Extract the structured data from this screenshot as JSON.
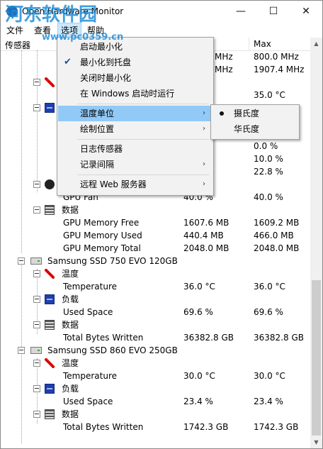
{
  "window": {
    "title": "Open Hardware Monitor",
    "minimize_glyph": "—",
    "maximize_glyph": "☐",
    "close_glyph": "✕"
  },
  "watermark": {
    "text": "河东软件园",
    "url": "www.pc0359.cn"
  },
  "menubar": {
    "file": "文件",
    "view": "查看",
    "options": "选项",
    "help": "帮助"
  },
  "columns": {
    "sensor": "传感器",
    "value": "",
    "max": "Max"
  },
  "partial_rows": [
    {
      "value": "MHz",
      "max": "800.0 MHz"
    },
    {
      "value": "MHz",
      "max": "1907.4 MHz"
    },
    {
      "value": "",
      "max": "35.0 °C"
    },
    {
      "value": "",
      "max": "0.0 %"
    },
    {
      "value": "",
      "max": "10.0 %"
    },
    {
      "value": "",
      "max": "22.8 %"
    }
  ],
  "gpu_fan": {
    "label": "GPU Fan",
    "value": "40.0 %",
    "max": "40.0 %"
  },
  "gpu_data": {
    "group": "数据",
    "rows": [
      {
        "label": "GPU Memory Free",
        "value": "1607.6 MB",
        "max": "1609.2 MB"
      },
      {
        "label": "GPU Memory Used",
        "value": "440.4 MB",
        "max": "466.0 MB"
      },
      {
        "label": "GPU Memory Total",
        "value": "2048.0 MB",
        "max": "2048.0 MB"
      }
    ]
  },
  "disks": [
    {
      "name": "Samsung SSD 750 EVO 120GB",
      "temp_group": "温度",
      "temp": {
        "label": "Temperature",
        "value": "36.0 °C",
        "max": "36.0 °C"
      },
      "load_group": "负载",
      "load": {
        "label": "Used Space",
        "value": "69.6 %",
        "max": "69.6 %"
      },
      "data_group": "数据",
      "data": {
        "label": "Total Bytes Written",
        "value": "36382.8 GB",
        "max": "36382.8 GB"
      }
    },
    {
      "name": "Samsung SSD 860 EVO 250GB",
      "temp_group": "温度",
      "temp": {
        "label": "Temperature",
        "value": "30.0 °C",
        "max": "30.0 °C"
      },
      "load_group": "负载",
      "load": {
        "label": "Used Space",
        "value": "23.4 %",
        "max": "23.4 %"
      },
      "data_group": "数据",
      "data": {
        "label": "Total Bytes Written",
        "value": "1742.3 GB",
        "max": "1742.3 GB"
      }
    }
  ],
  "options_menu": {
    "items": [
      "启动最小化",
      "最小化到托盘",
      "关闭时最小化",
      "在 Windows 启动时运行",
      "温度单位",
      "绘制位置",
      "日志传感器",
      "记录间隔",
      "远程 Web 服务器"
    ],
    "checked_item": "最小化到托盘",
    "check_glyph": "✔",
    "arrow_glyph": "›"
  },
  "temp_unit_submenu": {
    "items": [
      "摄氏度",
      "华氏度"
    ],
    "selected": "摄氏度"
  },
  "scroll": {
    "up_glyph": "▲",
    "down_glyph": "▼"
  },
  "colors": {
    "menu_highlight": "#91c9f7",
    "menu_bg": "#f2f2f2",
    "watermark": "#1a8ad6"
  }
}
